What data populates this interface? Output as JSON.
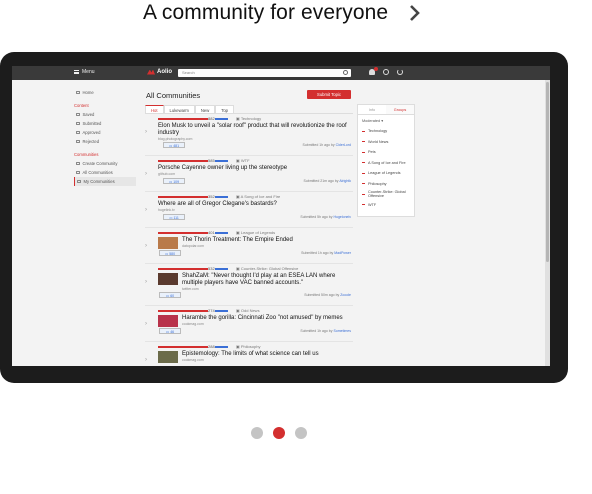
{
  "headline": {
    "title": "A community for everyone"
  },
  "app": {
    "menu_label": "Menu",
    "logo_text": "Aolio",
    "search_placeholder": "Search"
  },
  "sidebar": {
    "home": "Home",
    "content_heading": "Content",
    "content_items": [
      "Saved",
      "Submitted",
      "Approved",
      "Rejected"
    ],
    "communities_heading": "Communities",
    "community_items": [
      "Create Community",
      "All Communities",
      "My Communities"
    ]
  },
  "main": {
    "title": "All Communities",
    "submit_label": "Submit Topic",
    "tabs": [
      "Hot",
      "Lukewarm",
      "New",
      "Top"
    ],
    "posts": [
      {
        "score": "882",
        "community": "Technology",
        "title": "Elon Musk to unveil a \"solar roof\" product that will revolutionize the roof industry",
        "domain": "blog.photography.com",
        "comments": "481",
        "submitted": "Submitted 1h ago by",
        "user": "CiderLord",
        "thumb": false
      },
      {
        "score": "585",
        "community": "WTF",
        "title": "Porsche Cayenne owner living up the stereotype",
        "domain": "github.com",
        "comments": "109",
        "submitted": "Submitted 21m ago by",
        "user": "Alrightk",
        "thumb": false
      },
      {
        "score": "352",
        "community": "A Song of Ice and Fire",
        "title": "Where are all of Gregor Clegane's bastards?",
        "domain": "hugelink.tv",
        "comments": "111",
        "submitted": "Submitted 5h ago by",
        "user": "Hugelonelv",
        "thumb": false
      },
      {
        "score": "401",
        "community": "League of Legends",
        "title": "The Thorin Treatment: The Empire Ended",
        "domain": "datopolar.com",
        "comments": "580",
        "submitted": "Submitted 1h ago by",
        "user": "MadPower",
        "thumb": true
      },
      {
        "score": "532",
        "community": "Counter-Strike: Global Offensive",
        "title": "ShahZaM: \"Never thought I'd play at an ESEA LAN where multiple players have VAC banned accounts.\"",
        "domain": "twitter.com",
        "comments": "60",
        "submitted": "Submitted 50m ago by",
        "user": "Zooole",
        "thumb": true
      },
      {
        "score": "274",
        "community": "Odd News",
        "title": "Harambe the gorilla: Cincinnati Zoo \"not amused\" by memes",
        "domain": "cookmag.com",
        "comments": "46",
        "submitted": "Submitted 1h ago by",
        "user": "Sometimes",
        "thumb": true
      },
      {
        "score": "288",
        "community": "Philosophy",
        "title": "Epistemology: The limits of what science can tell us",
        "domain": "cookmag.com",
        "comments": "",
        "submitted": "",
        "user": "",
        "thumb": true
      }
    ]
  },
  "right_panel": {
    "tabs": [
      "Info",
      "Groups"
    ],
    "filter": "Moderated",
    "items": [
      "Technology",
      "World News",
      "Pets",
      "A Song of Ice and Fire",
      "League of Legends",
      "Philosophy",
      "Counter-Strike: Global Offensive",
      "WTF"
    ]
  },
  "carousel": {
    "active_index": 1,
    "count": 3
  },
  "colors": {
    "accent": "#d32f2f",
    "link": "#3b6fd6",
    "device": "#1c1c1c"
  }
}
